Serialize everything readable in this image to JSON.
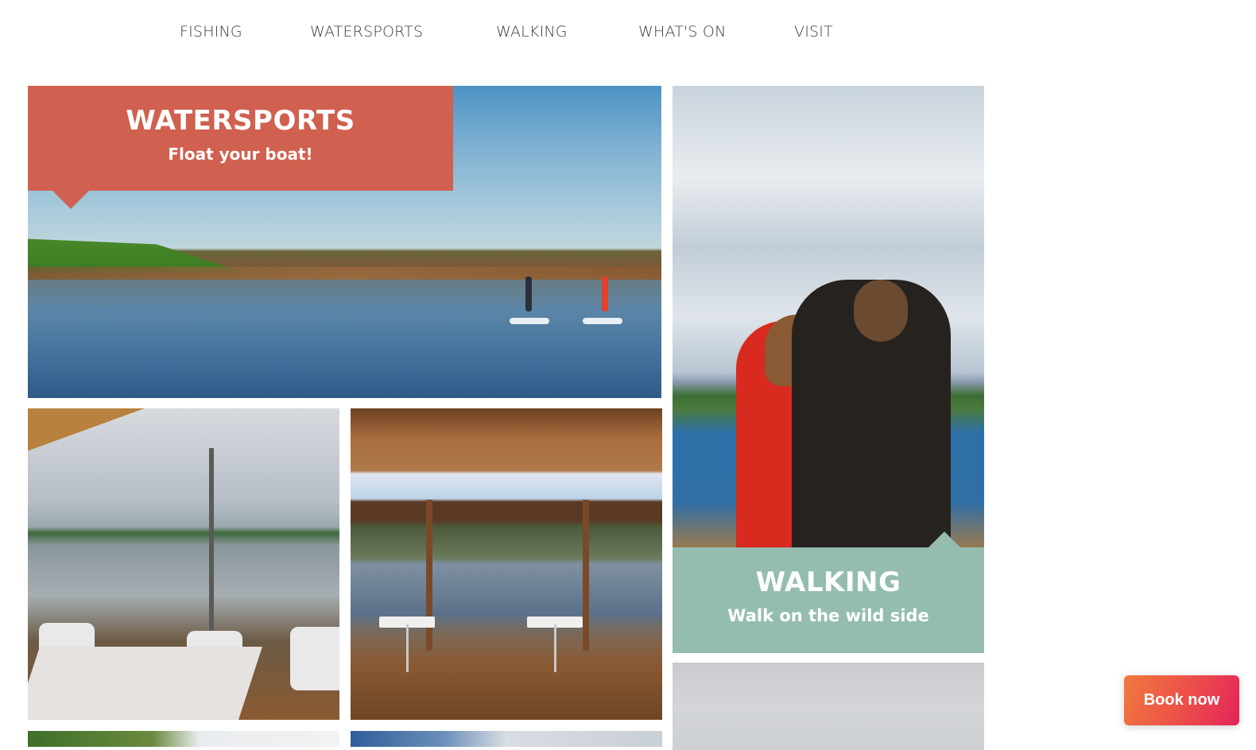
{
  "nav": {
    "items": [
      {
        "label": "FISHING"
      },
      {
        "label": "WATERSPORTS"
      },
      {
        "label": "WALKING"
      },
      {
        "label": "WHAT'S ON"
      },
      {
        "label": "VISIT"
      }
    ]
  },
  "tiles": {
    "watersports": {
      "title": "WATERSPORTS",
      "subtitle": "Float your boat!",
      "banner_color": "#d0604f",
      "image": "paddleboarders-on-lake"
    },
    "walking": {
      "title": "WALKING",
      "subtitle": "Walk on the wild side",
      "banner_color": "#94bdb0",
      "image": "couple-by-lake"
    },
    "cafe_interior_1": {
      "image": "cafe-lake-view-terrace"
    },
    "cafe_interior_2": {
      "image": "cafe-tables-window"
    },
    "bottom_left": {
      "image": "partial-landscape"
    },
    "bottom_middle": {
      "image": "partial-sky"
    },
    "bottom_right": {
      "image": "partial-water"
    }
  },
  "cta": {
    "book_label": "Book now",
    "gradient_start": "#f07a3e",
    "gradient_end": "#e3245a"
  }
}
